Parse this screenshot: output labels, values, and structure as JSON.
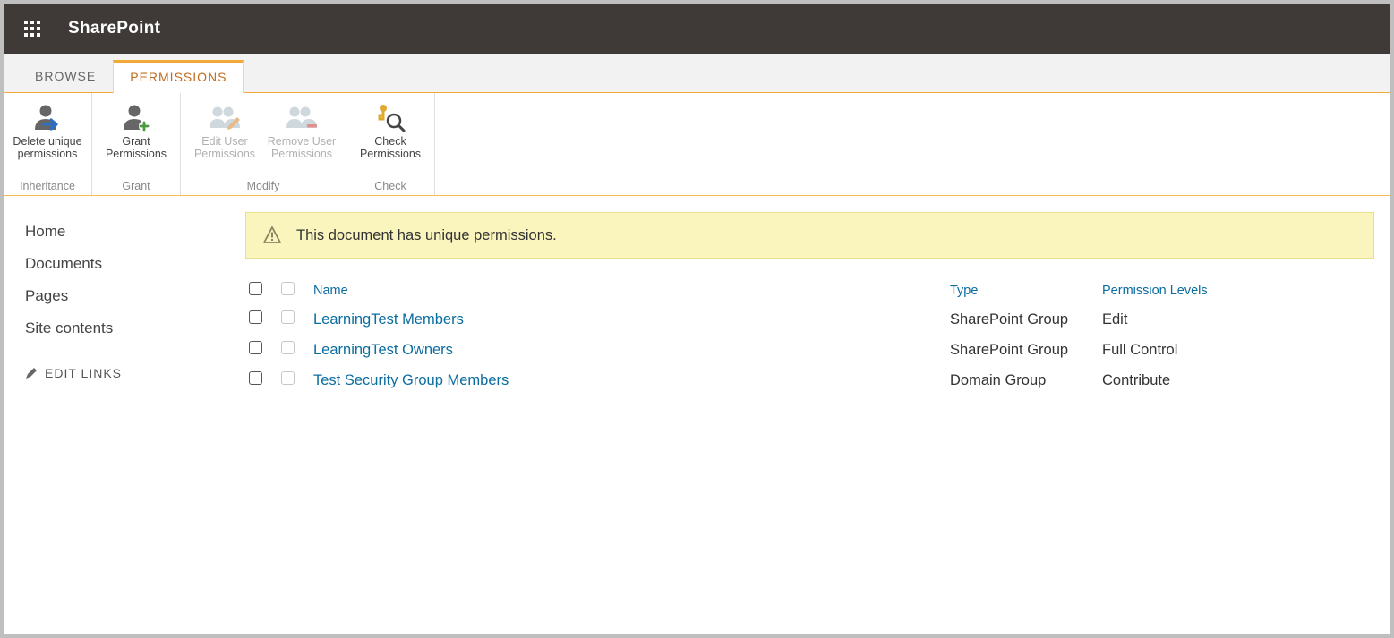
{
  "suite": {
    "product_name": "SharePoint"
  },
  "tabs": {
    "browse": "BROWSE",
    "permissions": "PERMISSIONS"
  },
  "ribbon": {
    "inheritance": {
      "caption": "Inheritance",
      "delete_unique": "Delete unique\npermissions"
    },
    "grant": {
      "caption": "Grant",
      "grant_permissions": "Grant\nPermissions"
    },
    "modify": {
      "caption": "Modify",
      "edit_user": "Edit User\nPermissions",
      "remove_user": "Remove User\nPermissions"
    },
    "check": {
      "caption": "Check",
      "check_permissions": "Check\nPermissions"
    }
  },
  "sidebar": {
    "home": "Home",
    "documents": "Documents",
    "pages": "Pages",
    "site_contents": "Site contents",
    "edit_links": "EDIT LINKS"
  },
  "message": "This document has unique permissions.",
  "table": {
    "headers": {
      "name": "Name",
      "type": "Type",
      "levels": "Permission Levels"
    },
    "rows": [
      {
        "name": "LearningTest Members",
        "type": "SharePoint Group",
        "levels": "Edit"
      },
      {
        "name": "LearningTest Owners",
        "type": "SharePoint Group",
        "levels": "Full Control"
      },
      {
        "name": "Test Security Group Members",
        "type": "Domain Group",
        "levels": "Contribute"
      }
    ]
  }
}
